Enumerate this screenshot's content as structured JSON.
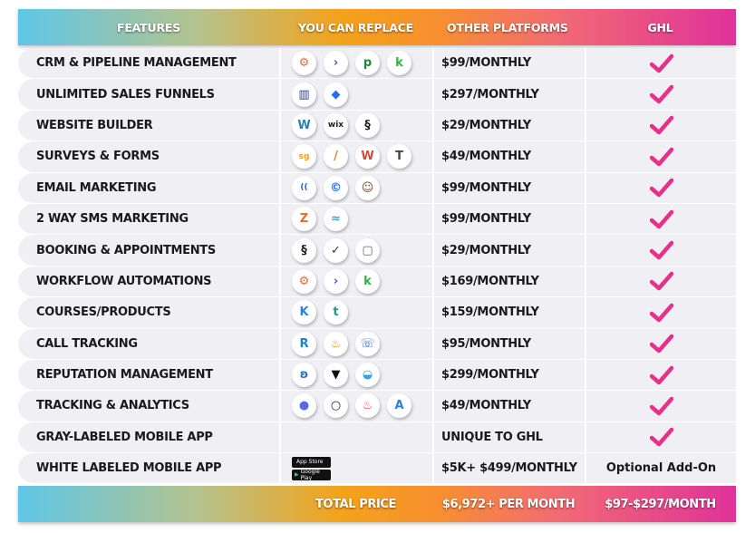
{
  "header": {
    "features": "FEATURES",
    "replace": "YOU CAN REPLACE",
    "other": "OTHER PLATFORMS",
    "ghl": "GHL"
  },
  "colors": {
    "check": "#e8308a",
    "gradient": [
      "#5ec6e8",
      "#b5c38e",
      "#f4a21a",
      "#f26b73",
      "#e0329a"
    ],
    "row_bg": "#efeff4"
  },
  "rows": [
    {
      "feature": "CRM & PIPELINE MANAGEMENT",
      "logos": [
        "hubspot",
        "activecampaign",
        "pipedrive",
        "keap"
      ],
      "other": "$99/MONTHLY",
      "ghl": "check"
    },
    {
      "feature": "UNLIMITED SALES FUNNELS",
      "logos": [
        "clickfunnels",
        "leadpages"
      ],
      "other": "$297/MONTHLY",
      "ghl": "check"
    },
    {
      "feature": "WEBSITE BUILDER",
      "logos": [
        "wordpress",
        "wix",
        "squarespace"
      ],
      "other": "$29/MONTHLY",
      "ghl": "check"
    },
    {
      "feature": "SURVEYS & FORMS",
      "logos": [
        "surveygizmo",
        "jotform",
        "wufoo",
        "typeform"
      ],
      "other": "$49/MONTHLY",
      "ghl": "check"
    },
    {
      "feature": "EMAIL MARKETING",
      "logos": [
        "constant-contact",
        "campaigner",
        "mailchimp"
      ],
      "other": "$99/MONTHLY",
      "ghl": "check"
    },
    {
      "feature": "2 WAY SMS MARKETING",
      "logos": [
        "zipwhip",
        "stackers"
      ],
      "other": "$99/MONTHLY",
      "ghl": "check"
    },
    {
      "feature": "BOOKING & APPOINTMENTS",
      "logos": [
        "squarespace",
        "acuity",
        "calendly"
      ],
      "other": "$29/MONTHLY",
      "ghl": "check"
    },
    {
      "feature": "WORKFLOW AUTOMATIONS",
      "logos": [
        "hubspot",
        "activecampaign",
        "keap"
      ],
      "other": "$169/MONTHLY",
      "ghl": "check"
    },
    {
      "feature": "COURSES/PRODUCTS",
      "logos": [
        "kajabi",
        "teachable"
      ],
      "other": "$159/MONTHLY",
      "ghl": "check"
    },
    {
      "feature": "CALL TRACKING",
      "logos": [
        "ringba",
        "callfire",
        "calltracking"
      ],
      "other": "$95/MONTHLY",
      "ghl": "check"
    },
    {
      "feature": "REPUTATION MANAGEMENT",
      "logos": [
        "birdeye",
        "podium",
        "grade-us"
      ],
      "other": "$299/MONTHLY",
      "ghl": "check"
    },
    {
      "feature": "TRACKING & ANALYTICS",
      "logos": [
        "pipedrive-p",
        "circle",
        "hotjar",
        "analytics"
      ],
      "other": "$49/MONTHLY",
      "ghl": "check"
    },
    {
      "feature": "GRAY-LABELED MOBILE APP",
      "logos": [],
      "other": "UNIQUE TO GHL",
      "ghl": "check"
    },
    {
      "feature": "WHITE LABELED MOBILE APP",
      "logos": [
        "app-store",
        "google-play"
      ],
      "other": "$5K+ $499/MONTHLY",
      "ghl": "Optional Add-On"
    }
  ],
  "stores": {
    "app_store": "App Store",
    "google_play": "Google Play"
  },
  "footer": {
    "label": "TOTAL PRICE",
    "other_total": "$6,972+ PER MONTH",
    "ghl_total": "$97-$297/MONTH"
  }
}
